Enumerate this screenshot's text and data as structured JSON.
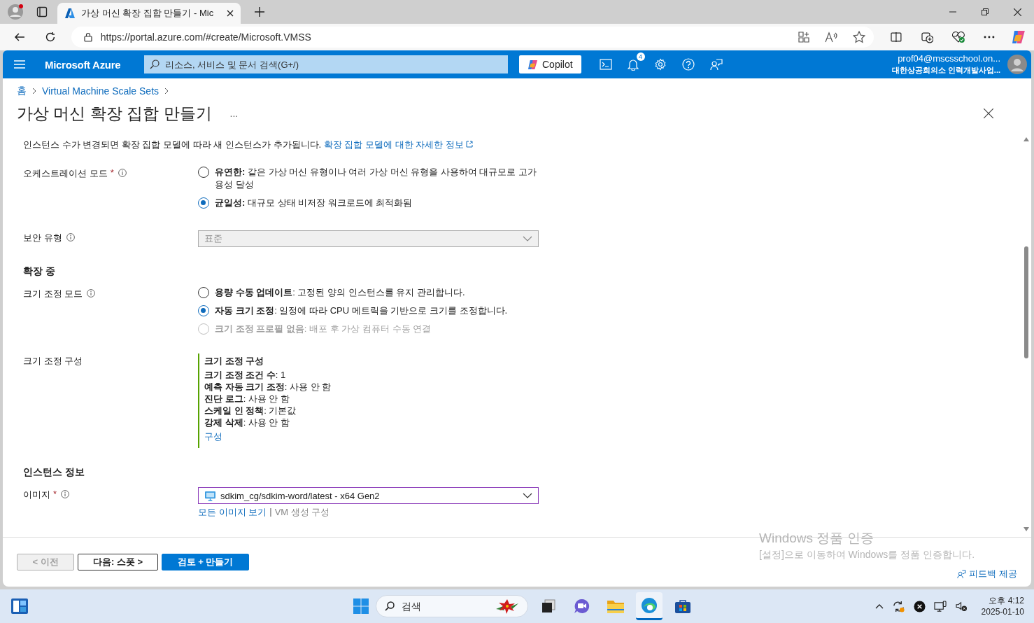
{
  "browser": {
    "tab": {
      "title": "가상 머신 확장 집합 만들기 - Mic"
    },
    "url": "https://portal.azure.com/#create/Microsoft.VMSS"
  },
  "portal": {
    "brand": "Microsoft Azure",
    "search_placeholder": "리소스, 서비스 및 문서 검색(G+/)",
    "copilot": "Copilot",
    "notification_count": "4",
    "account": {
      "email": "prof04@mscsschool.on...",
      "directory": "대한상공회의소 인력개발사업..."
    }
  },
  "breadcrumb": [
    "홈",
    "Virtual Machine Scale Sets"
  ],
  "page_title": "가상 머신 확장 집합 만들기",
  "more": "...",
  "intro": {
    "text": "인스턴스 수가 변경되면 확장 집합 모델에 따라 새 인스턴스가 추가됩니다.",
    "link": "확장 집합 모델에 대한 자세한 정보"
  },
  "fields": [
    {
      "kind": "radio",
      "label": "오케스트레이션 모드",
      "required": "*",
      "info": true,
      "options": [
        {
          "text": "**유연한:** 같은 가상 머신 유형이나 여러 가상 머신 유형을 사용하여 대규모로 고가용성 달성",
          "selected": false,
          "disabled": false
        },
        {
          "text": "**균일성:** 대규모 상태 비저장 워크로드에 최적화됨",
          "selected": true,
          "disabled": false
        }
      ]
    },
    {
      "kind": "select",
      "label": "보안 유형",
      "info": true,
      "value": "표준",
      "disabled": true,
      "focused": false
    },
    {
      "kind": "heading",
      "label": "확장 중"
    },
    {
      "kind": "radio",
      "label": "크기 조정 모드",
      "info": true,
      "options": [
        {
          "text": "**용량 수동 업데이트**: 고정된 양의 인스턴스를 유지 관리합니다.",
          "selected": false,
          "disabled": false
        },
        {
          "text": "**자동 크기 조정**: 일정에 따라 CPU 메트릭을 기반으로 크기를 조정합니다.",
          "selected": true,
          "disabled": false
        },
        {
          "text": "**크기 조정 프로필 없음**: 배포 후 가상 컴퓨터 수동 연결",
          "selected": false,
          "disabled": true
        }
      ]
    },
    {
      "kind": "summary",
      "label": "크기 조정 구성",
      "title": "크기 조정 구성",
      "rows": [
        "**크기 조정 조건 수**: 1",
        "**예측 자동 크기 조정**: 사용 안 함",
        "**진단 로그**: 사용 안 함",
        "**스케일 인 정책**: 기본값",
        "**강제 삭제**: 사용 안 함"
      ],
      "link": "구성"
    },
    {
      "kind": "heading",
      "label": "인스턴스 정보"
    },
    {
      "kind": "select",
      "label": "이미지",
      "required": "*",
      "info": true,
      "value": "sdkim_cg/sdkim-word/latest - x64 Gen2",
      "disabled": false,
      "focused": true,
      "separator": "|",
      "links": [
        {
          "label": "모든 이미지 보기",
          "disabled": false
        },
        {
          "label": "VM 생성 구성",
          "disabled": true
        }
      ]
    }
  ],
  "footer": {
    "buttons": [
      {
        "label": "< 이전",
        "kind": "disabled"
      },
      {
        "label": "다음: 스폿 >",
        "kind": "secondary"
      },
      {
        "label": "검토 + 만들기",
        "kind": "primary"
      }
    ],
    "feedback": "피드백 제공"
  },
  "activation": {
    "title": "Windows 정품 인증",
    "text": "[설정]으로 이동하여 Windows를 정품 인증합니다."
  },
  "taskbar": {
    "search_placeholder": "검색",
    "apps": [
      {
        "kind": "taskview",
        "active": false
      },
      {
        "kind": "teams",
        "active": false
      },
      {
        "kind": "explorer",
        "active": false
      },
      {
        "kind": "edge",
        "active": true
      },
      {
        "kind": "store",
        "active": false
      }
    ],
    "time": "오후 4:12",
    "date": "2025-01-10"
  }
}
